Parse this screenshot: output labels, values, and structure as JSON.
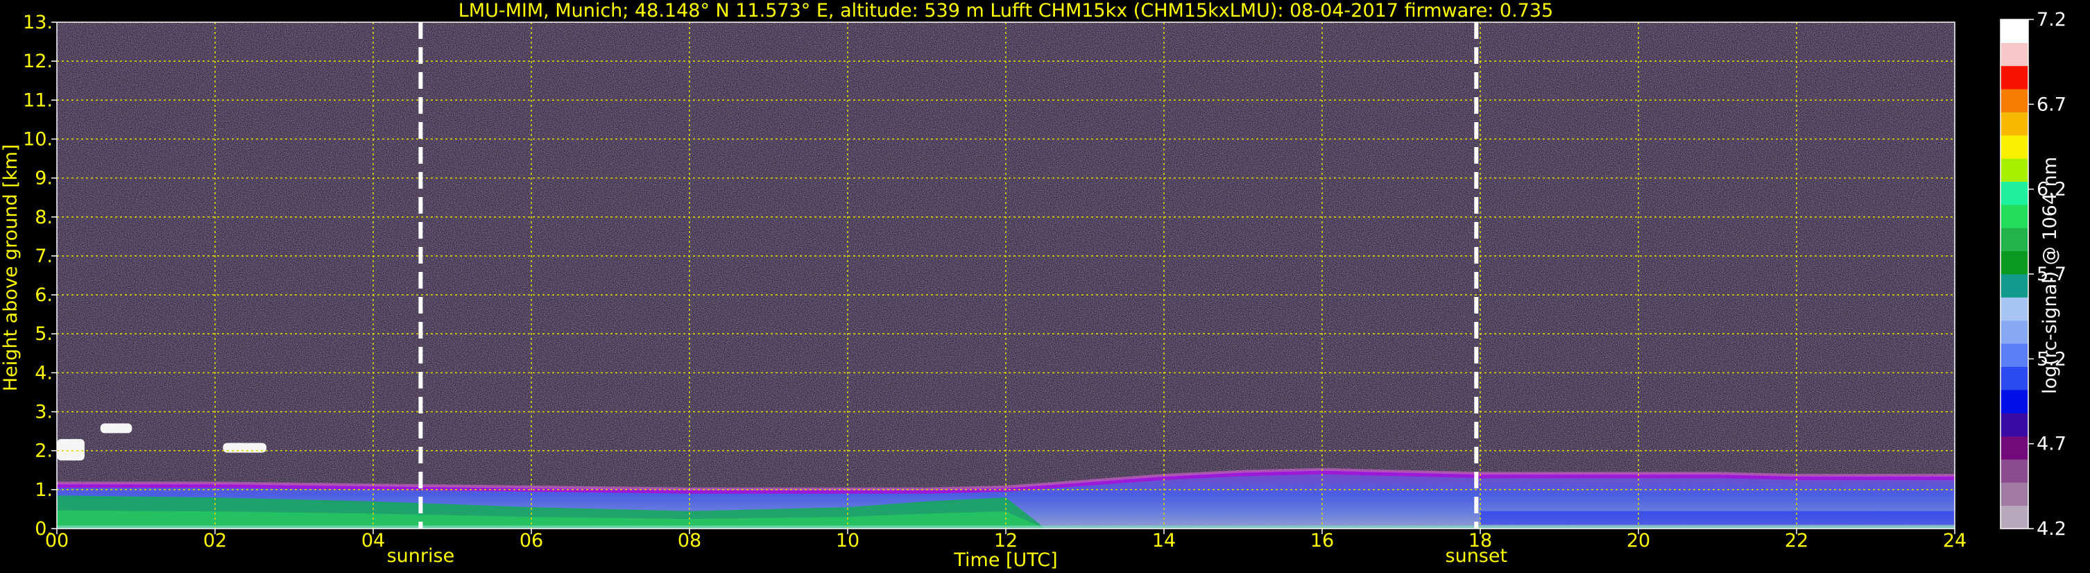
{
  "chart_data": {
    "type": "heatmap",
    "title": "LMU-MIM, Munich; 48.148° N 11.573° E, altitude: 539 m     Lufft CHM15kx (CHM15kxLMU): 08-04-2017     firmware: 0.735",
    "xlabel": "Time [UTC]",
    "ylabel": "Height above ground [km]",
    "xlim": [
      0,
      24
    ],
    "ylim": [
      0,
      13
    ],
    "x_ticks": [
      "00",
      "02",
      "04",
      "06",
      "08",
      "10",
      "12",
      "14",
      "16",
      "18",
      "20",
      "22",
      "24"
    ],
    "y_ticks": [
      "0.",
      "1.",
      "2.",
      "3.",
      "4.",
      "5.",
      "6.",
      "7.",
      "8.",
      "9.",
      "10.",
      "11.",
      "12.",
      "13."
    ],
    "grid": true,
    "markers": [
      {
        "label": "sunrise",
        "x": 4.6
      },
      {
        "label": "sunset",
        "x": 17.95
      }
    ],
    "colorbar": {
      "label": "log(rc-signal) @ 1064 nm",
      "ticks": [
        "4.2",
        "4.7",
        "5.2",
        "5.7",
        "6.2",
        "6.7",
        "7.2"
      ],
      "range": [
        4.2,
        7.2
      ],
      "colors": [
        "#b8a8bc",
        "#a07aa2",
        "#8a4c8c",
        "#720a7a",
        "#3a0aa4",
        "#0010e6",
        "#2a4cf2",
        "#5a7ef4",
        "#88a8f4",
        "#a8c4f2",
        "#129a8c",
        "#0a9a22",
        "#22b44a",
        "#22dc5a",
        "#1ef0a0",
        "#a8f000",
        "#f8f000",
        "#f8b800",
        "#f87c00",
        "#f81000",
        "#f8c8c8",
        "#ffffff"
      ]
    },
    "boundary_layer_top_km": [
      {
        "x": 0,
        "y": 1.1
      },
      {
        "x": 2,
        "y": 1.1
      },
      {
        "x": 4,
        "y": 1.05
      },
      {
        "x": 6,
        "y": 1.0
      },
      {
        "x": 8,
        "y": 0.95
      },
      {
        "x": 10,
        "y": 0.95
      },
      {
        "x": 11,
        "y": 0.95
      },
      {
        "x": 12,
        "y": 1.0
      },
      {
        "x": 13,
        "y": 1.15
      },
      {
        "x": 14,
        "y": 1.3
      },
      {
        "x": 15,
        "y": 1.4
      },
      {
        "x": 16,
        "y": 1.45
      },
      {
        "x": 17,
        "y": 1.4
      },
      {
        "x": 18,
        "y": 1.35
      },
      {
        "x": 19,
        "y": 1.35
      },
      {
        "x": 20,
        "y": 1.35
      },
      {
        "x": 21,
        "y": 1.35
      },
      {
        "x": 22,
        "y": 1.3
      },
      {
        "x": 23,
        "y": 1.3
      },
      {
        "x": 24,
        "y": 1.3
      }
    ],
    "mixed_layer_top_km": [
      {
        "x": 0,
        "y": 0.85
      },
      {
        "x": 2,
        "y": 0.8
      },
      {
        "x": 4,
        "y": 0.7
      },
      {
        "x": 6,
        "y": 0.55
      },
      {
        "x": 8,
        "y": 0.45
      },
      {
        "x": 10,
        "y": 0.55
      },
      {
        "x": 11,
        "y": 0.7
      },
      {
        "x": 12,
        "y": 0.8
      },
      {
        "x": 13,
        "y": 0.0
      },
      {
        "x": 24,
        "y": 0.0
      }
    ],
    "clouds": [
      {
        "x0": 0.0,
        "x1": 0.35,
        "y0": 1.75,
        "y1": 2.3
      },
      {
        "x0": 0.55,
        "x1": 0.95,
        "y0": 2.45,
        "y1": 2.7
      },
      {
        "x0": 2.1,
        "x1": 2.65,
        "y0": 1.95,
        "y1": 2.2
      }
    ]
  }
}
